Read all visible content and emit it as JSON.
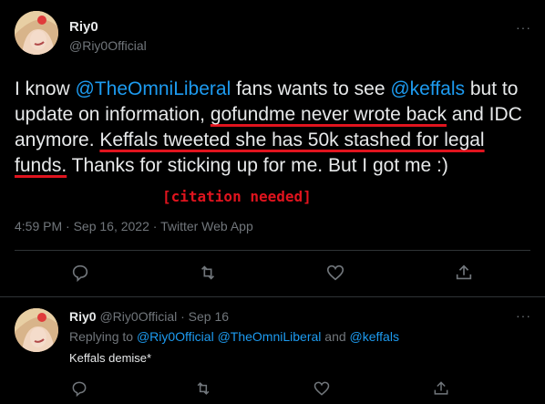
{
  "main_tweet": {
    "display_name": "Riy0",
    "handle": "@Riy0Official",
    "more_label": "···",
    "body": {
      "t1": "I know ",
      "m1": "@TheOmniLiberal",
      "t2": " fans wants to see ",
      "m2": "@keffals",
      "t3": " but to update on information, ",
      "u1": "gofundme never wrote back",
      "t4": " and IDC anymore. ",
      "u2": "Keffals tweeted she has 50k stashed for legal funds.",
      "t5": " Thanks for sticking up for me. But I got me :)"
    },
    "annotation": "[citation needed]",
    "timestamp": "4:59 PM · Sep 16, 2022 · Twitter Web App"
  },
  "reply_tweet": {
    "display_name": "Riy0",
    "handle": "@Riy0Official",
    "date": "· Sep 16",
    "more_label": "···",
    "replying_prefix": "Replying to ",
    "replying_to": "@Riy0Official @TheOmniLiberal",
    "replying_and": " and ",
    "replying_to_last": "@keffals",
    "text": "Keffals demise*"
  },
  "colors": {
    "background": "#000000",
    "text": "#e7e9ea",
    "secondary": "#71767b",
    "mention": "#1d9bf0",
    "annotation_red": "#e0141e"
  },
  "icons": [
    "reply-icon",
    "retweet-icon",
    "like-icon",
    "share-icon",
    "more-icon"
  ]
}
